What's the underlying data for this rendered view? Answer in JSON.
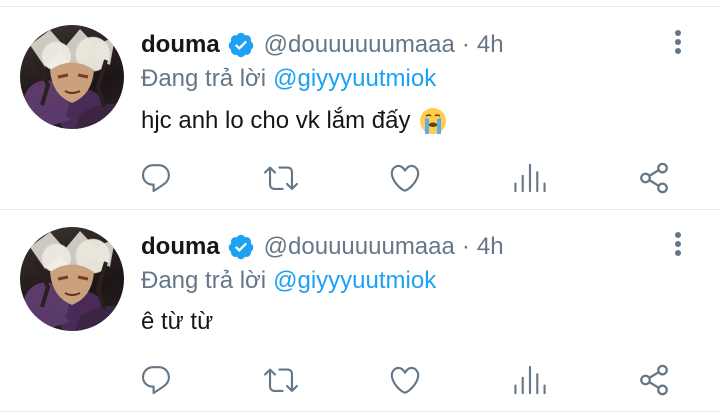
{
  "tweets": [
    {
      "display_name": "douma",
      "handle": "@douuuuuumaaa",
      "separator": "·",
      "time": "4h",
      "reply_prefix": "Đang trả lời",
      "reply_to": "@giyyyuutmiok",
      "text": "hjc anh lo cho vk lắm đấy",
      "emoji": "loudly-crying-face-icon"
    },
    {
      "display_name": "douma",
      "handle": "@douuuuuumaaa",
      "separator": "·",
      "time": "4h",
      "reply_prefix": "Đang trả lời",
      "reply_to": "@giyyyuutmiok",
      "text": "ê từ từ"
    }
  ],
  "colors": {
    "primary_text": "#14171a",
    "secondary_text": "#657786",
    "link": "#1da1f2",
    "divider": "#e6ecf0",
    "icon": "#657786"
  }
}
